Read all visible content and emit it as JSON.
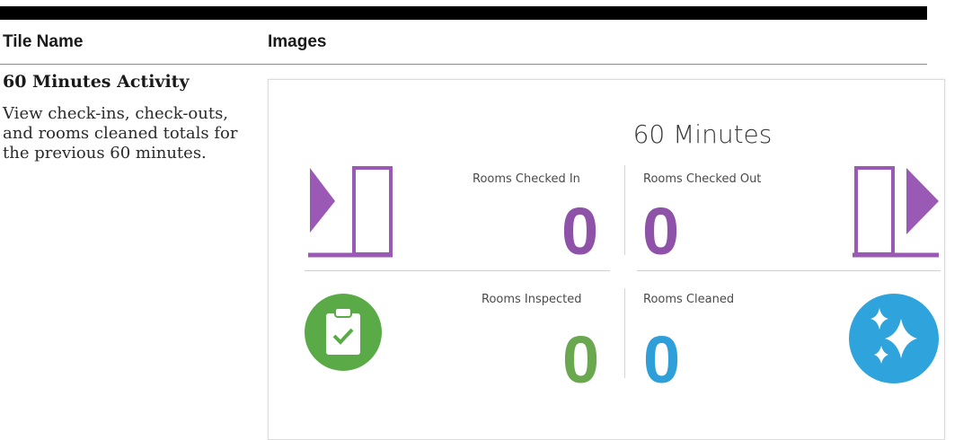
{
  "table": {
    "headers": {
      "tile_name": "Tile Name",
      "images": "Images"
    },
    "row": {
      "name": "60 Minutes Activity",
      "description": "View check-ins, check-outs, and rooms cleaned totals for the previous 60 minutes."
    }
  },
  "tile": {
    "title": "60 Minutes",
    "stats": {
      "checked_in": {
        "label": "Rooms Checked In",
        "value": "0",
        "color": "#8e52a8"
      },
      "checked_out": {
        "label": "Rooms Checked Out",
        "value": "0",
        "color": "#8e52a8"
      },
      "inspected": {
        "label": "Rooms Inspected",
        "value": "0",
        "color": "#6aa84f"
      },
      "cleaned": {
        "label": "Rooms Cleaned",
        "value": "0",
        "color": "#2e9fd8"
      }
    },
    "icons": {
      "checked_in": "check-in-door-icon",
      "checked_out": "check-out-door-icon",
      "inspected": "clipboard-check-icon",
      "cleaned": "sparkle-icon"
    },
    "colors": {
      "purple": "#9b59b6",
      "green": "#5aaa47",
      "blue": "#2fa3dc"
    }
  }
}
